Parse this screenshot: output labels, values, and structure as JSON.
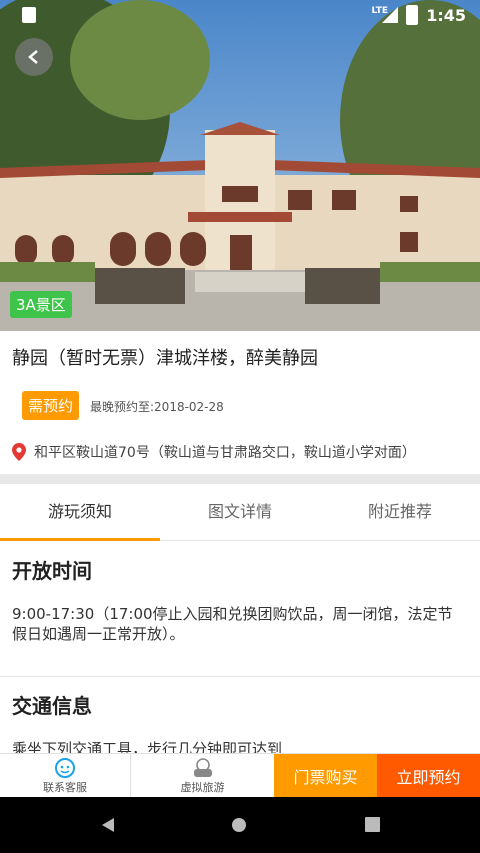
{
  "status_bar": {
    "time": "1:45",
    "network": "LTE"
  },
  "hero": {
    "badge": "3A景区"
  },
  "detail": {
    "title": "静园（暂时无票）津城洋楼，醉美静园",
    "reserve_tag": "需预约",
    "deadline": "最晚预约至:2018-02-28",
    "address": "和平区鞍山道70号（鞍山道与甘肃路交口，鞍山道小学对面）"
  },
  "tabs": [
    {
      "label": "游玩须知"
    },
    {
      "label": "图文详情"
    },
    {
      "label": "附近推荐"
    }
  ],
  "sections": {
    "open_time": {
      "title": "开放时间",
      "body": "9:00-17:30（17:00停止入园和兑换团购饮品，周一闭馆，法定节假日如遇周一正常开放）。"
    },
    "traffic": {
      "title": "交通信息",
      "body": "乘坐下列交通工具，步行几分钟即可达到"
    }
  },
  "bottom_bar": {
    "service": "联系客服",
    "vr": "虚拟旅游",
    "buy": "门票购买",
    "book": "立即预约"
  },
  "colors": {
    "accent": "#ff9a00",
    "book": "#ff5a00",
    "badge": "#3ec44a"
  }
}
